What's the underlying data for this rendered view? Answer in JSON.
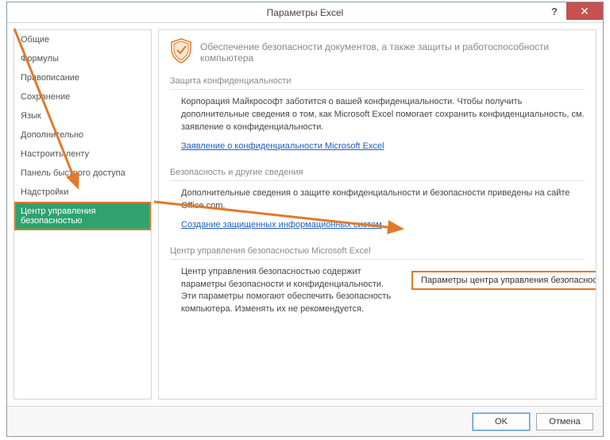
{
  "window": {
    "title": "Параметры Excel",
    "help_tooltip": "?",
    "close_tooltip": "✕"
  },
  "sidebar": {
    "items": [
      {
        "label": "Общие"
      },
      {
        "label": "Формулы"
      },
      {
        "label": "Правописание"
      },
      {
        "label": "Сохранение"
      },
      {
        "label": "Язык"
      },
      {
        "label": "Дополнительно"
      },
      {
        "label": "Настроить ленту"
      },
      {
        "label": "Панель быстрого доступа"
      },
      {
        "label": "Надстройки"
      },
      {
        "label": "Центр управления безопасностью"
      }
    ]
  },
  "hero": {
    "text": "Обеспечение безопасности документов, а также защиты и работоспособности компьютера"
  },
  "privacy": {
    "title": "Защита конфиденциальности",
    "body": "Корпорация Майкрософт заботится о вашей конфиденциальности. Чтобы получить дополнительные сведения о том, как Microsoft Excel помогает сохранить конфиденциальность, см. заявление о конфиденциальности.",
    "link": "Заявление о конфиденциальности Microsoft Excel"
  },
  "security": {
    "title": "Безопасность и другие сведения",
    "body": "Дополнительные сведения о защите конфиденциальности и безопасности приведены на сайте Office.com.",
    "link": "Создание защищенных информационных систем"
  },
  "trustcenter": {
    "title": "Центр управления безопасностью Microsoft Excel",
    "body": "Центр управления безопасностью содержит параметры безопасности и конфиденциальности. Эти параметры помогают обеспечить безопасность компьютера. Изменять их не рекомендуется.",
    "button": "Параметры центра управления безопасностью..."
  },
  "footer": {
    "ok": "OK",
    "cancel": "Отмена"
  }
}
